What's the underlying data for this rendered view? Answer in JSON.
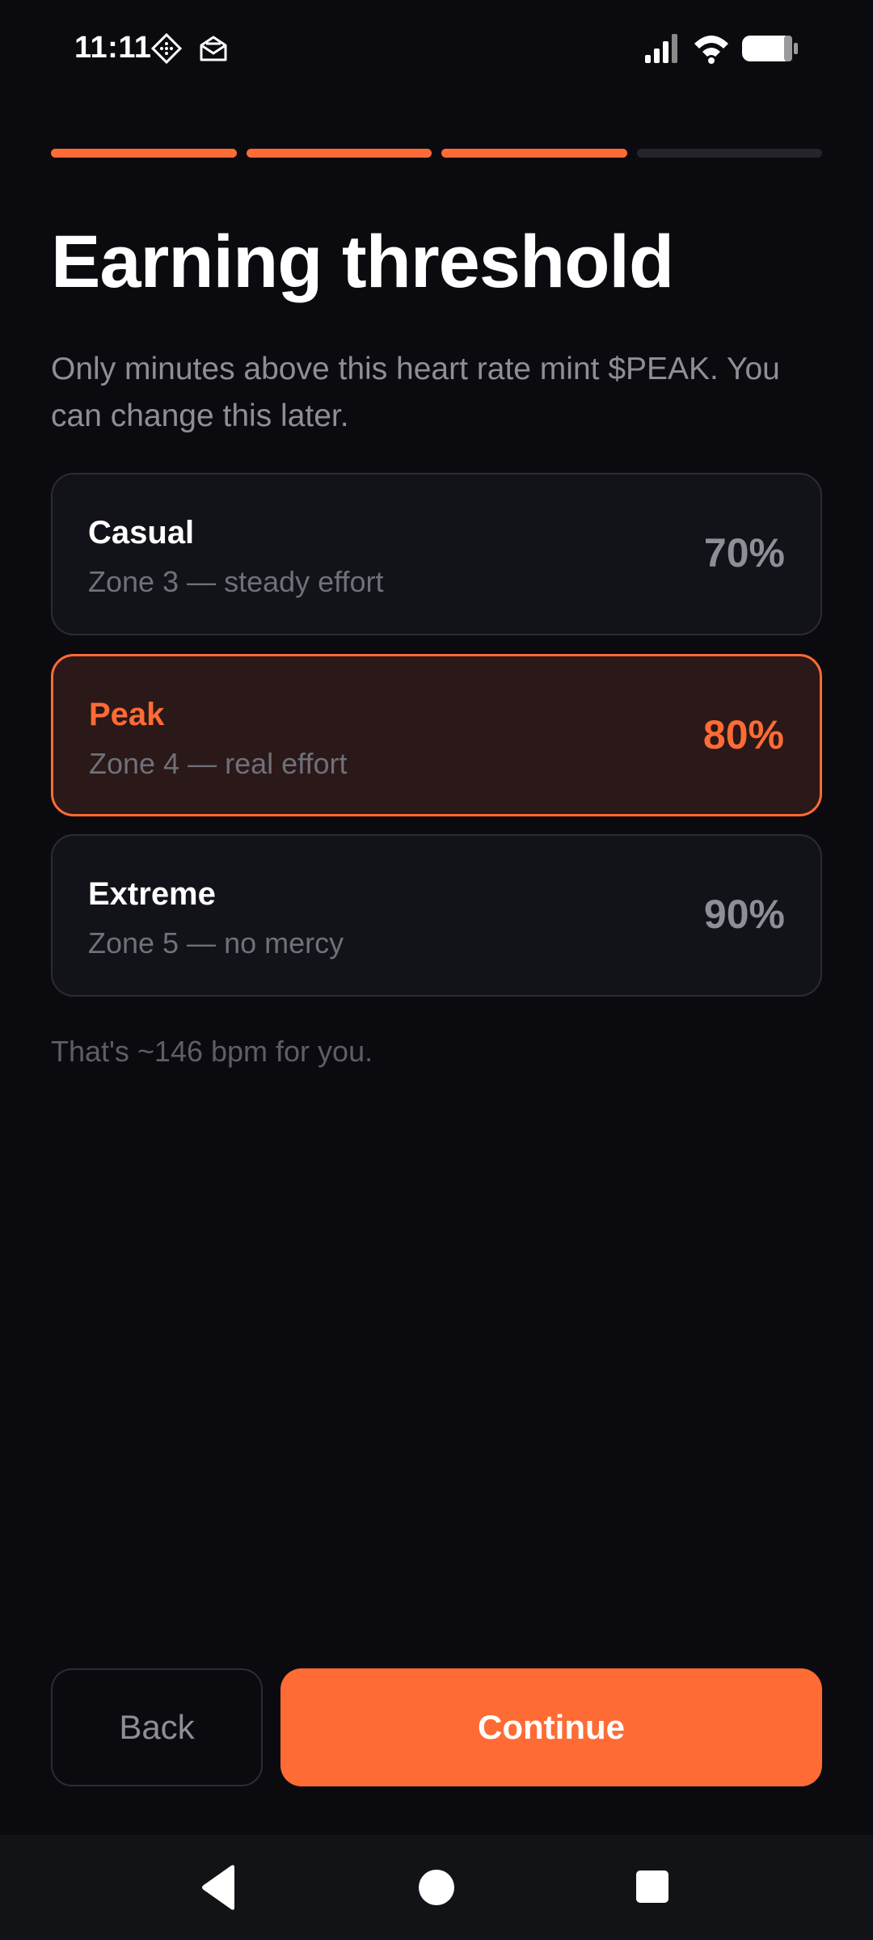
{
  "status_bar": {
    "time": "11:11",
    "icons": [
      "diamond-app-icon",
      "mail-open-icon",
      "signal-icon",
      "wifi-icon",
      "battery-icon"
    ]
  },
  "progress": {
    "total_steps": 4,
    "completed_steps": 3
  },
  "header": {
    "title": "Earning threshold",
    "subtitle": "Only minutes above this heart rate mint $PEAK. You can change this later."
  },
  "options": [
    {
      "name": "Casual",
      "description": "Zone 3 — steady effort",
      "percent": "70%",
      "selected": false
    },
    {
      "name": "Peak",
      "description": "Zone 4 — real effort",
      "percent": "80%",
      "selected": true
    },
    {
      "name": "Extreme",
      "description": "Zone 5 — no mercy",
      "percent": "90%",
      "selected": false
    }
  ],
  "bpm_note": "That's ~146 bpm for you.",
  "buttons": {
    "back_label": "Back",
    "continue_label": "Continue"
  },
  "colors": {
    "accent": "#ff6b35",
    "background": "#0b0b0f",
    "card": "#121219",
    "selected_card": "#2b1818"
  },
  "nav_bar": {
    "icons": [
      "back-triangle-icon",
      "home-circle-icon",
      "recents-square-icon"
    ]
  }
}
